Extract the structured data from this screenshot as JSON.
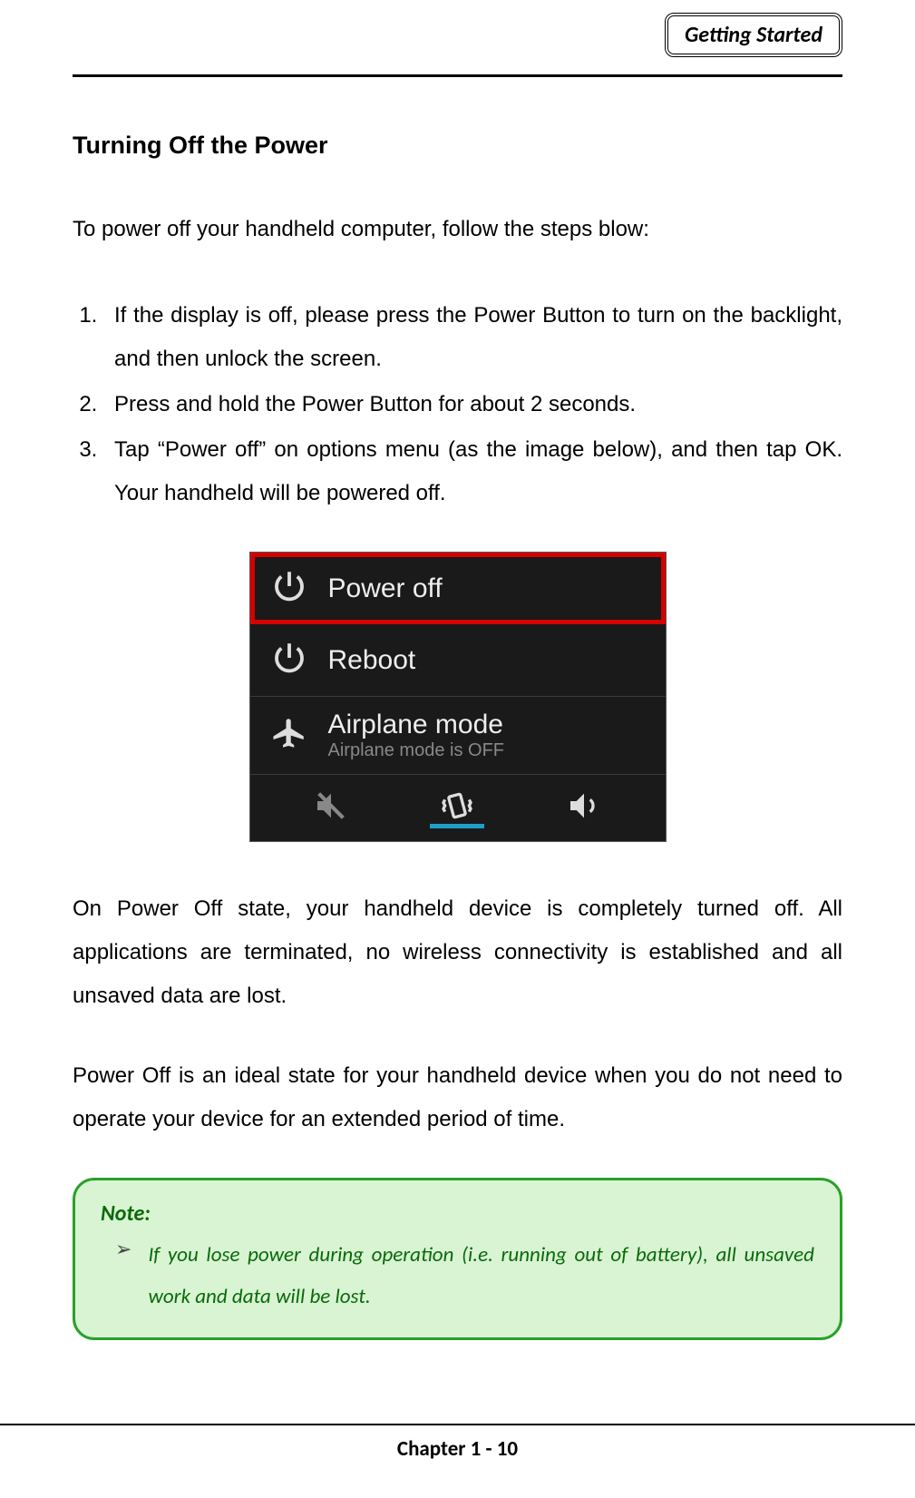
{
  "header": {
    "tag": "Getting Started"
  },
  "title": "Turning Off the Power",
  "intro": "To power off your handheld computer, follow the steps blow:",
  "steps": [
    "If the display is off, please press the Power Button to turn on the backlight, and then unlock the screen.",
    "Press and hold the Power Button for about 2 seconds.",
    "Tap “Power off” on options menu (as the image below), and then tap OK. Your handheld will be powered off."
  ],
  "menu": {
    "power_off": "Power off",
    "reboot": "Reboot",
    "airplane": "Airplane mode",
    "airplane_sub": "Airplane mode is OFF"
  },
  "para1": "On Power Off state, your handheld device is completely turned off. All applications are terminated, no wireless connectivity is established and all unsaved data are lost.",
  "para2": "Power Off is an ideal state for your handheld device when you do not need to operate your device for an extended period of time.",
  "note": {
    "title": "Note:",
    "bullet": "➢",
    "text": "If you lose power during operation (i.e. running out of battery), all unsaved work and data will be lost."
  },
  "footer": "Chapter 1 - 10"
}
